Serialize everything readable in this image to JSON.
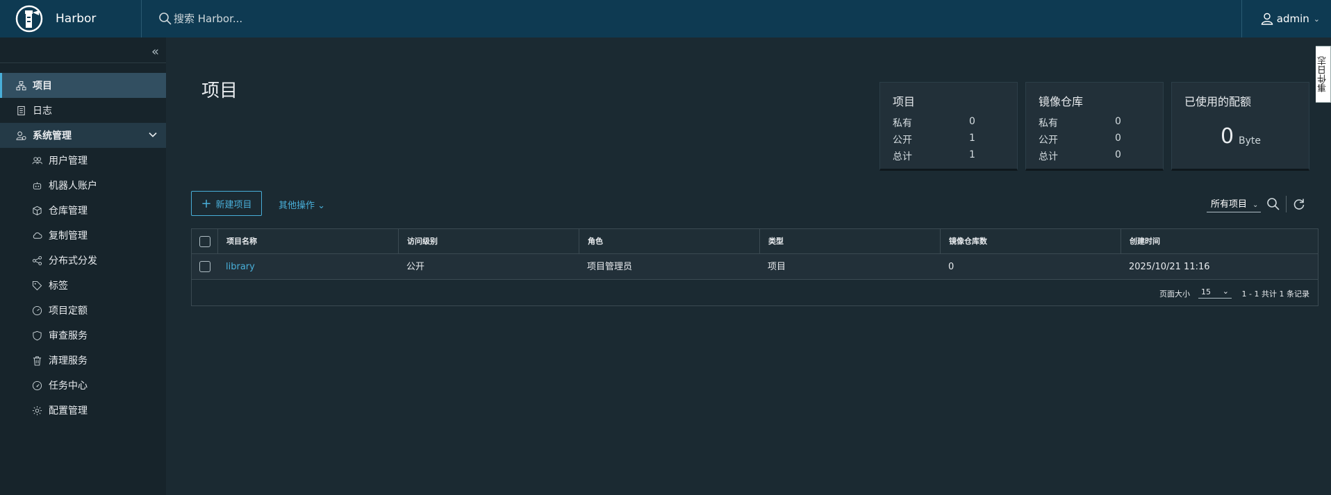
{
  "header": {
    "brand": "Harbor",
    "search_placeholder": "搜索 Harbor...",
    "user": "admin"
  },
  "sidebar": {
    "items": [
      {
        "label": "项目",
        "icon": "projects-icon"
      },
      {
        "label": "日志",
        "icon": "logs-icon"
      },
      {
        "label": "系统管理",
        "icon": "admin-icon"
      }
    ],
    "sub_items": [
      {
        "label": "用户管理",
        "icon": "users-icon"
      },
      {
        "label": "机器人账户",
        "icon": "robot-icon"
      },
      {
        "label": "仓库管理",
        "icon": "registry-icon"
      },
      {
        "label": "复制管理",
        "icon": "replication-icon"
      },
      {
        "label": "分布式分发",
        "icon": "distribution-icon"
      },
      {
        "label": "标签",
        "icon": "tag-icon"
      },
      {
        "label": "项目定额",
        "icon": "quota-icon"
      },
      {
        "label": "审查服务",
        "icon": "shield-icon"
      },
      {
        "label": "清理服务",
        "icon": "trash-icon"
      },
      {
        "label": "任务中心",
        "icon": "dashboard-icon"
      },
      {
        "label": "配置管理",
        "icon": "gear-icon"
      }
    ]
  },
  "main": {
    "title": "项目",
    "cards": {
      "projects": {
        "title": "项目",
        "rows": [
          {
            "label": "私有",
            "value": "0"
          },
          {
            "label": "公开",
            "value": "1"
          },
          {
            "label": "总计",
            "value": "1"
          }
        ]
      },
      "repos": {
        "title": "镜像仓库",
        "rows": [
          {
            "label": "私有",
            "value": "0"
          },
          {
            "label": "公开",
            "value": "0"
          },
          {
            "label": "总计",
            "value": "0"
          }
        ]
      },
      "quota": {
        "title": "已使用的配额",
        "value": "0",
        "unit": "Byte"
      }
    },
    "new_project": "新建项目",
    "other_actions": "其他操作",
    "filter_select": "所有项目",
    "table": {
      "columns": [
        "项目名称",
        "访问级别",
        "角色",
        "类型",
        "镜像仓库数",
        "创建时间"
      ],
      "rows": [
        {
          "name": "library",
          "access": "公开",
          "role": "项目管理员",
          "type": "项目",
          "repo_count": "0",
          "created": "2025/10/21 11:16"
        }
      ],
      "page_size_label": "页面大小",
      "page_size": "15",
      "page_info": "1 - 1 共计 1 条记录"
    }
  },
  "edge_tab": "事件日志",
  "colors": {
    "header_bg": "#0e3a52",
    "accent": "#49afd9",
    "body_bg": "#1b2a32"
  }
}
